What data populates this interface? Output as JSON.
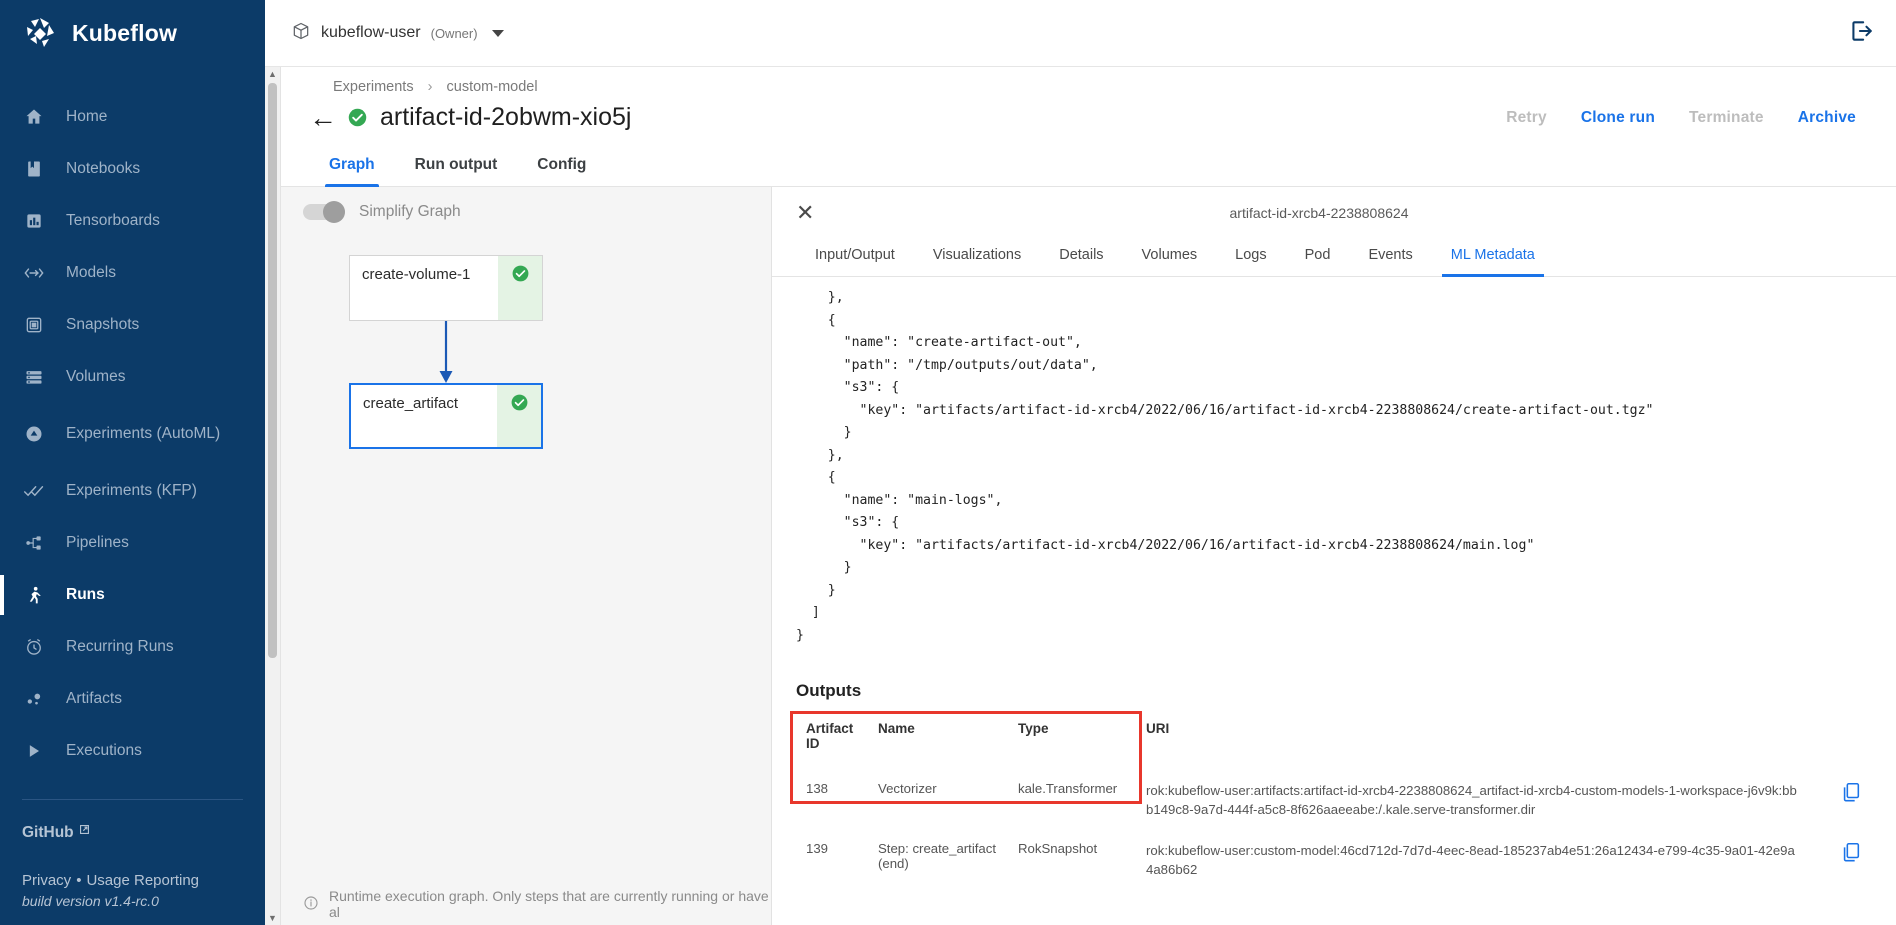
{
  "brand": {
    "name": "Kubeflow",
    "logo_icon": "kubeflow-logo-icon"
  },
  "sidebar": {
    "items": [
      {
        "label": "Home",
        "icon": "home-icon",
        "active": false
      },
      {
        "label": "Notebooks",
        "icon": "notebook-icon",
        "active": false
      },
      {
        "label": "Tensorboards",
        "icon": "bar-chart-icon",
        "active": false
      },
      {
        "label": "Models",
        "icon": "code-brackets-icon",
        "active": false
      },
      {
        "label": "Snapshots",
        "icon": "snapshot-icon",
        "active": false
      },
      {
        "label": "Volumes",
        "icon": "storage-icon",
        "active": false
      },
      {
        "label": "Experiments (AutoML)",
        "icon": "experiment-flask-icon",
        "active": false
      },
      {
        "label": "Experiments (KFP)",
        "icon": "double-check-icon",
        "active": false
      },
      {
        "label": "Pipelines",
        "icon": "pipeline-icon",
        "active": false
      },
      {
        "label": "Runs",
        "icon": "runner-icon",
        "active": true
      },
      {
        "label": "Recurring Runs",
        "icon": "alarm-clock-icon",
        "active": false
      },
      {
        "label": "Artifacts",
        "icon": "artifacts-dots-icon",
        "active": false
      },
      {
        "label": "Executions",
        "icon": "play-triangle-icon",
        "active": false
      }
    ],
    "github_label": "GitHub",
    "privacy_label": "Privacy",
    "separator_dot": "•",
    "usage_reporting_label": "Usage Reporting",
    "build_version": "build version v1.4-rc.0"
  },
  "topbar": {
    "namespace": "kubeflow-user",
    "role": "(Owner)",
    "namespace_icon": "package-cube-icon",
    "logout_icon": "logout-icon"
  },
  "breadcrumb": {
    "root": "Experiments",
    "separator": "›",
    "current": "custom-model"
  },
  "header": {
    "back_icon": "back-arrow-icon",
    "status_icon": "success-check-icon",
    "title": "artifact-id-2obwm-xio5j",
    "actions": [
      {
        "label": "Retry",
        "enabled": false
      },
      {
        "label": "Clone run",
        "enabled": true
      },
      {
        "label": "Terminate",
        "enabled": false
      },
      {
        "label": "Archive",
        "enabled": true
      }
    ]
  },
  "tabs": [
    {
      "label": "Graph",
      "active": true
    },
    {
      "label": "Run output",
      "active": false
    },
    {
      "label": "Config",
      "active": false
    }
  ],
  "graph": {
    "simplify_label": "Simplify Graph",
    "simplify_on": false,
    "nodes": [
      {
        "label": "create-volume-1",
        "status_icon": "success-check-icon",
        "selected": false
      },
      {
        "label": "create_artifact",
        "status_icon": "success-check-icon",
        "selected": true
      }
    ],
    "footer_info_icon": "info-circle-icon",
    "footer_text": "Runtime execution graph. Only steps that are currently running or have al"
  },
  "side_panel": {
    "close_icon": "close-x-icon",
    "title": "artifact-id-xrcb4-2238808624",
    "tabs": [
      {
        "label": "Input/Output",
        "active": false
      },
      {
        "label": "Visualizations",
        "active": false
      },
      {
        "label": "Details",
        "active": false
      },
      {
        "label": "Volumes",
        "active": false
      },
      {
        "label": "Logs",
        "active": false
      },
      {
        "label": "Pod",
        "active": false
      },
      {
        "label": "Events",
        "active": false
      },
      {
        "label": "ML Metadata",
        "active": true
      }
    ],
    "json_lines": [
      "    },",
      "    {",
      "      \"name\": \"create-artifact-out\",",
      "      \"path\": \"/tmp/outputs/out/data\",",
      "      \"s3\": {",
      "        \"key\": \"artifacts/artifact-id-xrcb4/2022/06/16/artifact-id-xrcb4-2238808624/create-artifact-out.tgz\"",
      "      }",
      "    },",
      "    {",
      "      \"name\": \"main-logs\",",
      "      \"s3\": {",
      "        \"key\": \"artifacts/artifact-id-xrcb4/2022/06/16/artifact-id-xrcb4-2238808624/main.log\"",
      "      }",
      "    }",
      "  ]",
      "}"
    ],
    "outputs": {
      "heading": "Outputs",
      "columns": [
        "Artifact ID",
        "Name",
        "Type",
        "URI"
      ],
      "rows": [
        {
          "artifact_id": "138",
          "name": "Vectorizer",
          "type": "kale.Transformer",
          "uri": "rok:kubeflow-user:artifacts:artifact-id-xrcb4-2238808624_artifact-id-xrcb4-custom-models-1-workspace-j6v9k:bbb149c8-9a7d-444f-a5c8-8f626aaeeabe:/.kale.serve-transformer.dir",
          "copy_icon": "copy-icon"
        },
        {
          "artifact_id": "139",
          "name": "Step: create_artifact (end)",
          "type": "RokSnapshot",
          "uri": "rok:kubeflow-user:custom-model:46cd712d-7d7d-4eec-8ead-185237ab4e51:26a12434-e799-4c35-9a01-42e9a4a86b62",
          "copy_icon": "copy-icon"
        }
      ]
    }
  },
  "colors": {
    "sidebar_bg": "#0c3b68",
    "accent_blue": "#1a73e8",
    "success_green": "#34a853",
    "highlight_red": "#e8372c"
  }
}
